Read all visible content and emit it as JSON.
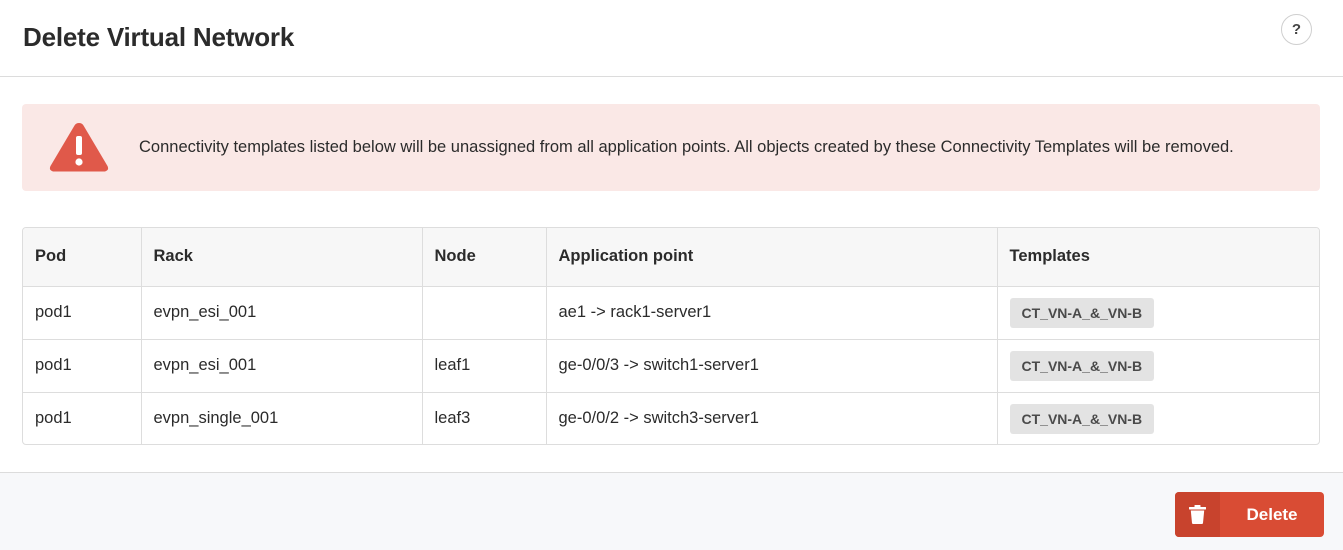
{
  "header": {
    "title": "Delete Virtual Network",
    "help_label": "?"
  },
  "alert": {
    "icon": "warning-triangle-icon",
    "message": "Connectivity templates listed below will be unassigned from all application points. All objects created by these Connectivity Templates will be removed."
  },
  "table": {
    "columns": [
      "Pod",
      "Rack",
      "Node",
      "Application point",
      "Templates"
    ],
    "rows": [
      {
        "pod": "pod1",
        "rack": "evpn_esi_001",
        "node": "",
        "application_point": "ae1 -> rack1-server1",
        "template": "CT_VN-A_&_VN-B"
      },
      {
        "pod": "pod1",
        "rack": "evpn_esi_001",
        "node": "leaf1",
        "application_point": "ge-0/0/3 -> switch1-server1",
        "template": "CT_VN-A_&_VN-B"
      },
      {
        "pod": "pod1",
        "rack": "evpn_single_001",
        "node": "leaf3",
        "application_point": "ge-0/0/2 -> switch3-server1",
        "template": "CT_VN-A_&_VN-B"
      }
    ]
  },
  "footer": {
    "delete_label": "Delete",
    "delete_icon": "trash-icon"
  },
  "colors": {
    "alert_bg": "#fae8e6",
    "warning": "#e0594a",
    "danger": "#d94c34",
    "tag_bg": "#e3e3e3"
  }
}
